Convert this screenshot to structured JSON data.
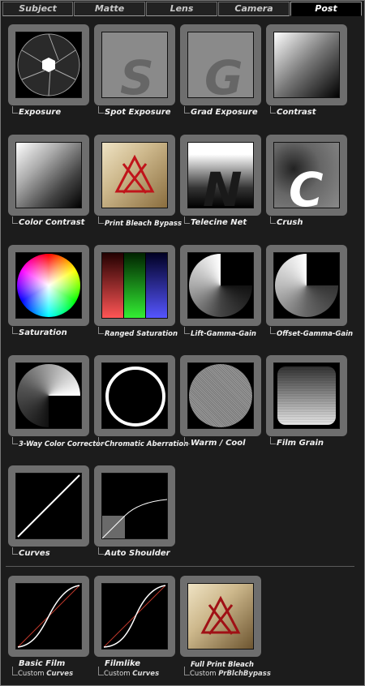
{
  "tabs": [
    {
      "label": "Subject",
      "active": false
    },
    {
      "label": "Matte",
      "active": false
    },
    {
      "label": "Lens",
      "active": false
    },
    {
      "label": "Camera",
      "active": false
    },
    {
      "label": "Post",
      "active": true
    }
  ],
  "items": {
    "exposure": {
      "label": "Exposure"
    },
    "spot_exposure": {
      "label": "Spot Exposure",
      "glyph": "S"
    },
    "grad_exposure": {
      "label": "Grad Exposure",
      "glyph": "G"
    },
    "contrast": {
      "label": "Contrast"
    },
    "color_contrast": {
      "label": "Color Contrast"
    },
    "print_bleach_bypass": {
      "label": "Print Bleach Bypass"
    },
    "telecine_net": {
      "label": "Telecine Net",
      "glyph": "N"
    },
    "crush": {
      "label": "Crush",
      "glyph": "C"
    },
    "saturation": {
      "label": "Saturation"
    },
    "ranged_saturation": {
      "label": "Ranged Saturation"
    },
    "lift_gamma_gain": {
      "label": "Lift-Gamma-Gain"
    },
    "offset_gamma_gain": {
      "label": "Offset-Gamma-Gain"
    },
    "three_way": {
      "label": "3-Way Color Corrector"
    },
    "chromatic_aberration": {
      "label": "Chromatic Aberration"
    },
    "warm_cool": {
      "label": "Warm / Cool"
    },
    "film_grain": {
      "label": "Film Grain"
    },
    "curves": {
      "label": "Curves"
    },
    "auto_shoulder": {
      "label": "Auto Shoulder"
    }
  },
  "custom": [
    {
      "label": "Basic Film",
      "sub_prefix": "Custom",
      "sub_name": "Curves"
    },
    {
      "label": "Filmlike",
      "sub_prefix": "Custom",
      "sub_name": "Curves"
    },
    {
      "label": "Full Print Bleach",
      "sub_prefix": "Custom",
      "sub_name": "PrBlchBypass"
    }
  ],
  "colors": {
    "tile": "#6e6e6e",
    "active_tab_bg": "#000000",
    "bleach_symbol": "#c0141a",
    "curve_red": "#c0392b"
  }
}
